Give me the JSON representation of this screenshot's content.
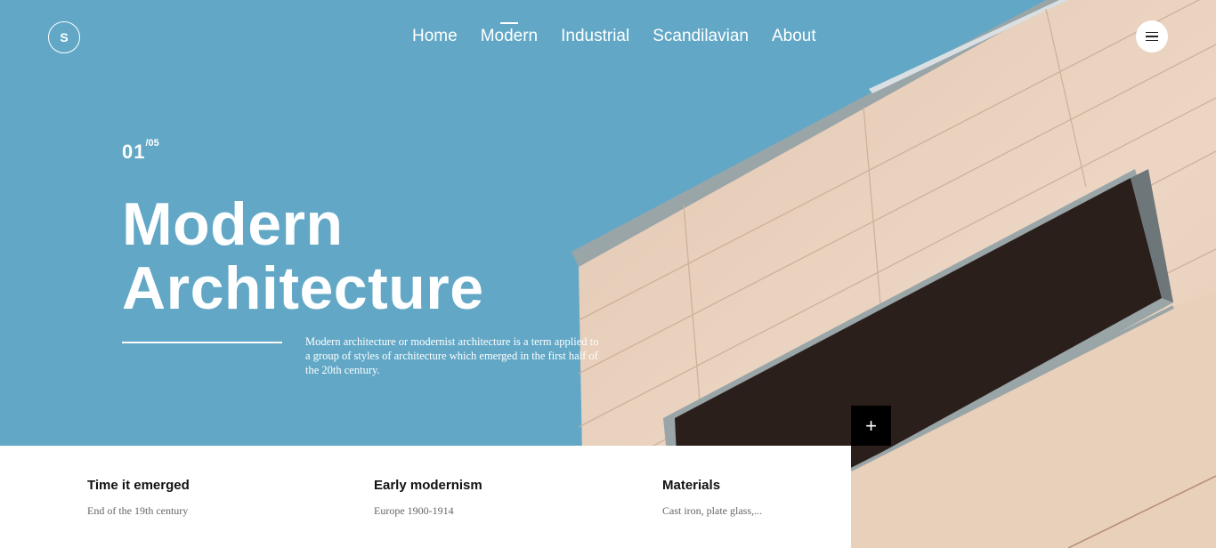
{
  "logo": {
    "letter": "S"
  },
  "nav": {
    "items": [
      {
        "label": "Home",
        "active": false
      },
      {
        "label": "Modern",
        "active": true
      },
      {
        "label": "Industrial",
        "active": false
      },
      {
        "label": "Scandilavian",
        "active": false
      },
      {
        "label": "About",
        "active": false
      }
    ]
  },
  "menu": {
    "icon": "hamburger-icon"
  },
  "slide": {
    "current": "01",
    "total": "/05"
  },
  "hero": {
    "title_line1": "Modern",
    "title_line2": "Architecture",
    "description": "Modern architecture or modernist architecture is a term applied to a group of styles of architecture which emerged in the first half of the 20th century."
  },
  "plus": {
    "label": "+",
    "icon": "plus-icon"
  },
  "info": [
    {
      "heading": "Time it emerged",
      "value": "End of the 19th century"
    },
    {
      "heading": "Early modernism",
      "value": "Europe 1900-1914"
    },
    {
      "heading": "Materials",
      "value": "Cast iron, plate glass,..."
    }
  ],
  "colors": {
    "sky": "#62a8c6",
    "facade": "#ebd5c2",
    "window": "#2b1f1b",
    "frame": "#9aa5a8"
  }
}
